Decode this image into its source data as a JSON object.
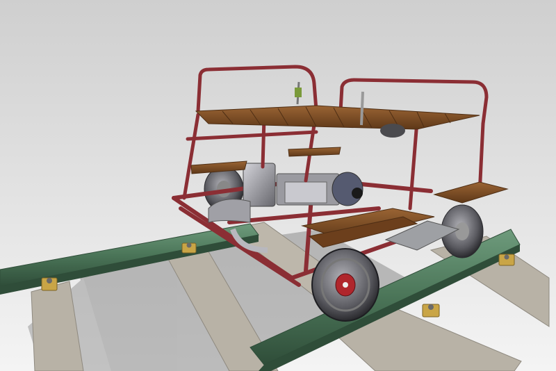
{
  "scene": {
    "subject": "rail-handcar-cad-render",
    "colors": {
      "background_top": "#cfcfcf",
      "background_bottom": "#f6f6f6",
      "ground_shadow": "#8c8c8c",
      "sleeper": "#b8b2a6",
      "sleeper_dark": "#8e897f",
      "rail": "#4b7558",
      "rail_light": "#6e9b7c",
      "rail_dark": "#2f4d39",
      "frame": "#8b2e34",
      "frame_light": "#b5545a",
      "wood": "#7a4a22",
      "wood_light": "#9a6434",
      "wood_dark": "#4e2e14",
      "wheel": "#5a5a60",
      "wheel_light": "#b0b0b6",
      "hub": "#b0262c",
      "engine": "#7c7c82",
      "engine_light": "#c9c9cf",
      "fastener": "#c9a546"
    },
    "icons": [
      "rail-track",
      "sleeper",
      "wheel",
      "engine-block",
      "wooden-deck",
      "seat-bench",
      "lever"
    ]
  }
}
